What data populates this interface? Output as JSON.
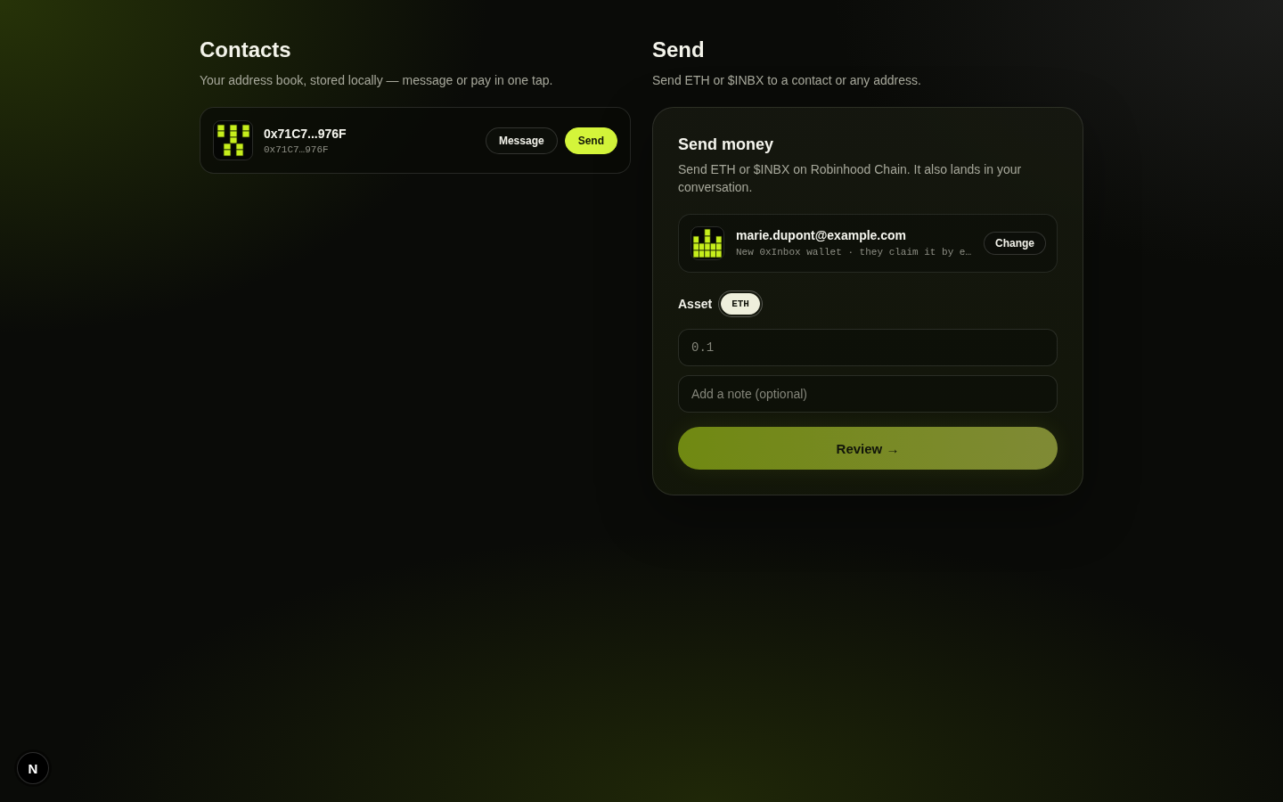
{
  "contacts": {
    "title": "Contacts",
    "subtitle": "Your address book, stored locally — message or pay in one tap.",
    "items": [
      {
        "name": "0x71C7...976F",
        "address": "0x71C7…976F",
        "actions": [
          {
            "label": "Message",
            "kind": "secondary"
          },
          {
            "label": "Send",
            "kind": "primary"
          }
        ]
      }
    ]
  },
  "send": {
    "title": "Send",
    "subtitle": "Send ETH or $INBX to a contact or any address.",
    "card": {
      "title": "Send money",
      "description": "Send ETH or $INBX on Robinhood Chain. It also lands in your conversation.",
      "recipient": {
        "name": "marie.dupont@example.com",
        "detail": "New 0xInbox wallet · they claim it by e…",
        "action": "Change"
      },
      "asset": {
        "label": "Asset",
        "options": [
          {
            "label": "ETH",
            "selected": true
          }
        ]
      },
      "amount": {
        "placeholder": "0.1"
      },
      "note": {
        "placeholder": "Add a note (optional)"
      },
      "submit": {
        "label": "Review →",
        "disabled": true
      }
    }
  },
  "dev_badge": {
    "label": "N"
  }
}
